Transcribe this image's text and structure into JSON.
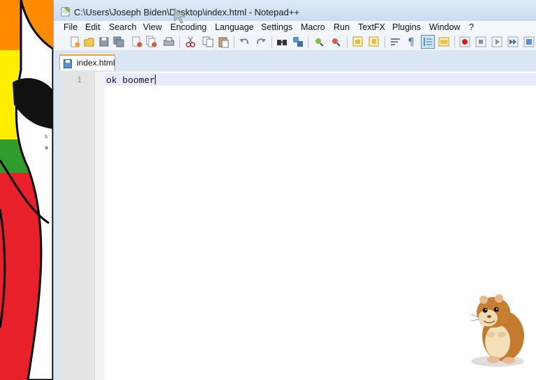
{
  "window": {
    "title": "C:\\Users\\Joseph Biden\\Desktop\\index.html - Notepad++"
  },
  "menu": {
    "items": [
      "File",
      "Edit",
      "Search",
      "View",
      "Encoding",
      "Language",
      "Settings",
      "Macro",
      "Run",
      "TextFX",
      "Plugins",
      "Window",
      "?"
    ]
  },
  "toolbar": {
    "icons": [
      "new-file-icon",
      "open-file-icon",
      "save-icon",
      "save-all-icon",
      "close-icon",
      "close-all-icon",
      "print-icon",
      "cut-icon",
      "copy-icon",
      "paste-icon",
      "undo-icon",
      "redo-icon",
      "find-icon",
      "replace-icon",
      "zoom-in-icon",
      "zoom-out-icon",
      "sync-vertical-icon",
      "sync-horizontal-icon",
      "word-wrap-icon",
      "show-all-characters-icon",
      "indent-guide-icon",
      "user-language-icon",
      "record-macro-icon",
      "stop-macro-icon",
      "playback-macro-icon",
      "run-macro-multiple-icon",
      "save-macro-icon"
    ],
    "active": "indent-guide-icon"
  },
  "tabs": [
    {
      "label": "index.html"
    }
  ],
  "editor": {
    "line_number": "1",
    "text": "ok boomer"
  },
  "colors": {
    "title_bar": "#cfdff2",
    "tab_accent": "#f7a432",
    "current_line": "#e8e8ff",
    "gutter": "#e4e4e4",
    "desktop_colors": [
      "#ff8c00",
      "#ffee00",
      "#2e9d2e",
      "#e8202a"
    ]
  }
}
